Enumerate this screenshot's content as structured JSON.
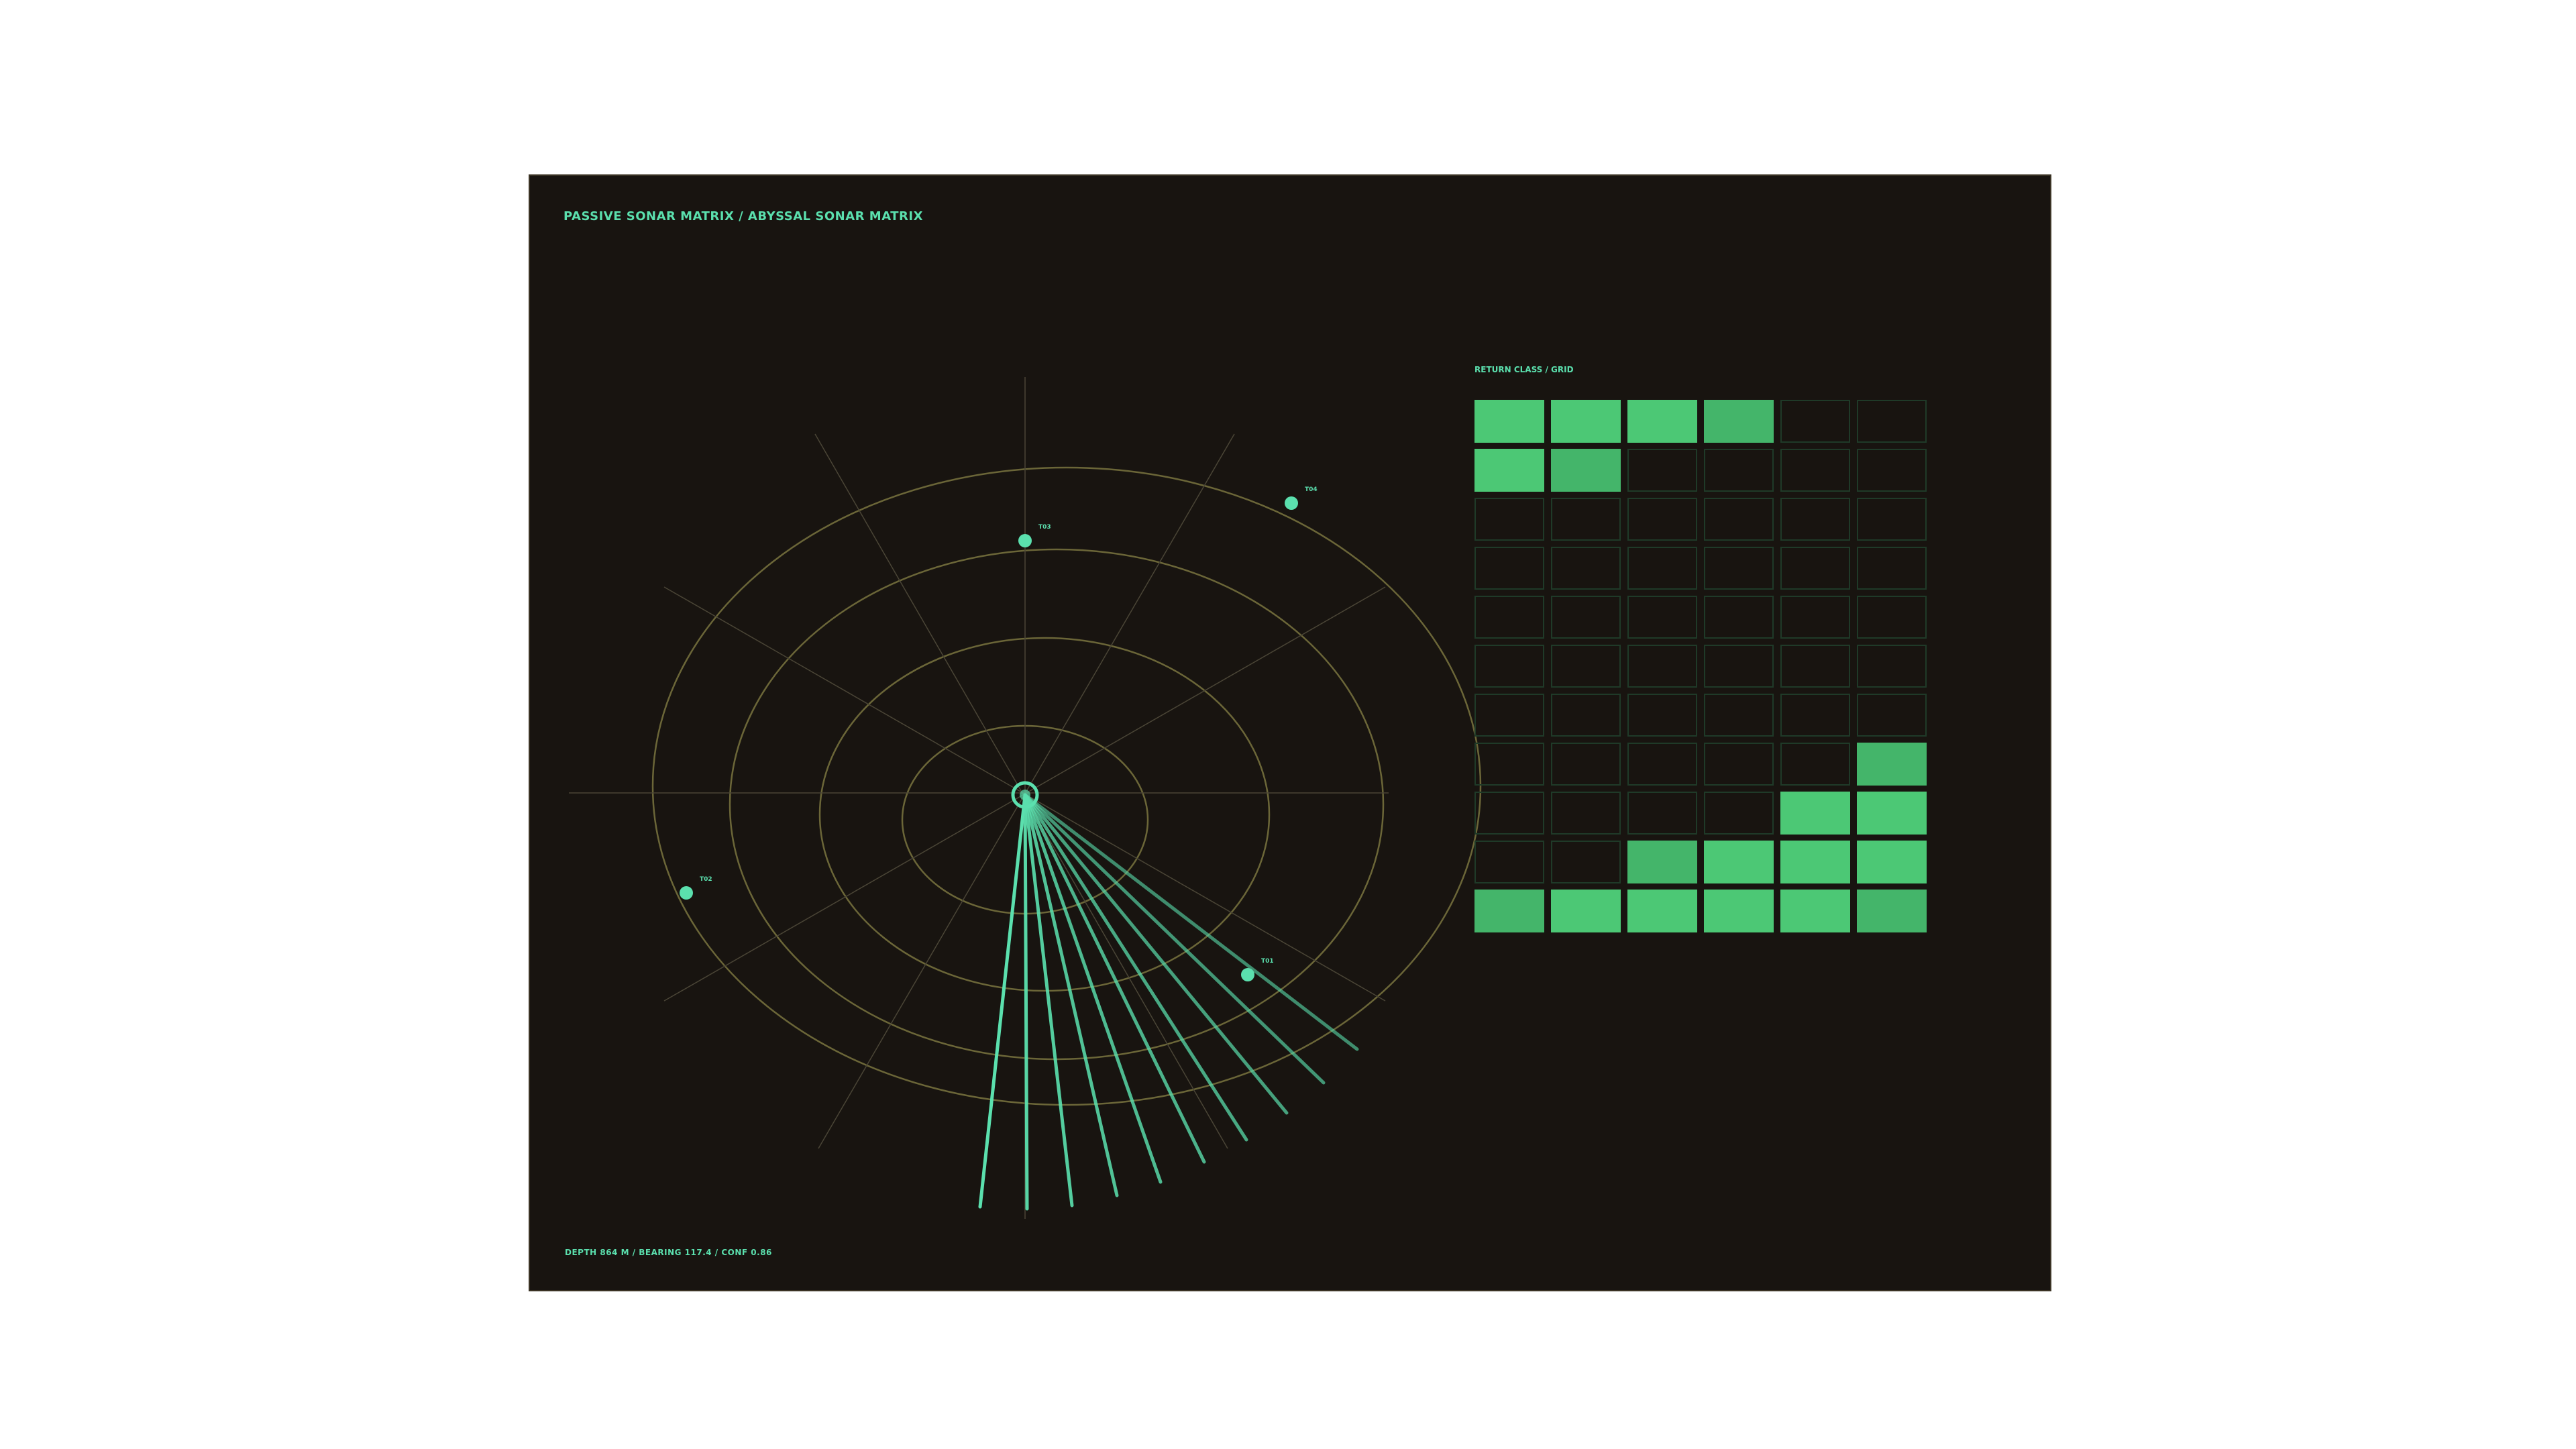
{
  "header": {
    "title": "PASSIVE SONAR MATRIX / ABYSSAL SONAR MATRIX"
  },
  "footer": {
    "readout": "DEPTH 864 M / BEARING 117.4 / CONF 0.86"
  },
  "grid": {
    "label": "RETURN CLASS / GRID",
    "rows": 11,
    "cols": 6,
    "cells": [
      [
        1,
        1,
        1,
        2,
        0,
        0
      ],
      [
        1,
        2,
        0,
        0,
        0,
        0
      ],
      [
        0,
        0,
        0,
        0,
        0,
        0
      ],
      [
        0,
        0,
        0,
        0,
        0,
        0
      ],
      [
        0,
        0,
        0,
        0,
        0,
        0
      ],
      [
        0,
        0,
        0,
        0,
        0,
        0
      ],
      [
        0,
        0,
        0,
        0,
        0,
        0
      ],
      [
        0,
        0,
        0,
        0,
        0,
        2
      ],
      [
        0,
        0,
        0,
        0,
        1,
        1
      ],
      [
        0,
        0,
        2,
        1,
        1,
        1
      ],
      [
        2,
        1,
        1,
        1,
        1,
        2
      ]
    ]
  },
  "targets": [
    {
      "label": "T03"
    },
    {
      "label": "T04"
    },
    {
      "label": "T02"
    },
    {
      "label": "T01"
    }
  ],
  "colors": {
    "accent": "#5be0ae",
    "ring": "#6b6638",
    "cell_on": "#4cc875",
    "cell_alt": "#44b56a",
    "cell_off_border": "#1f3a28"
  }
}
